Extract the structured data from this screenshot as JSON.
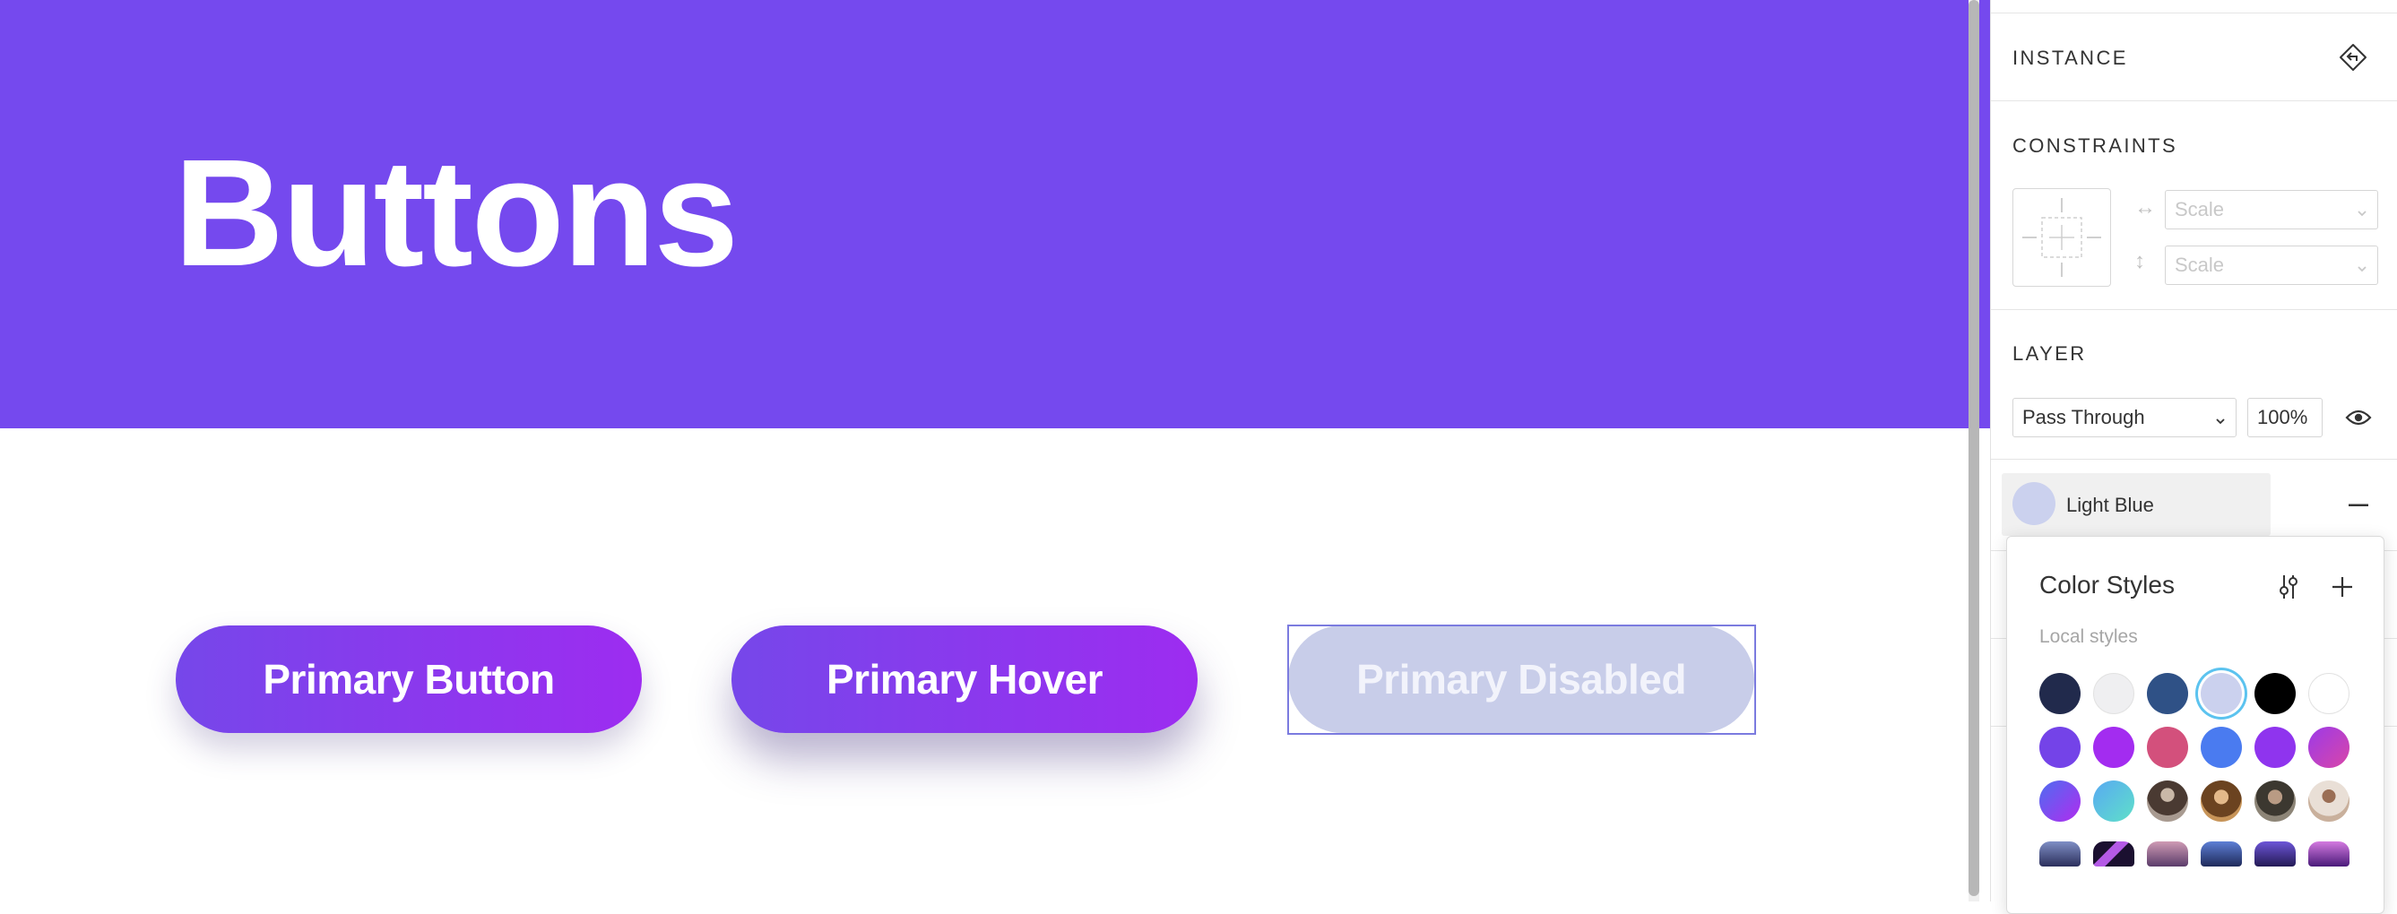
{
  "canvas": {
    "title": "Buttons",
    "buttons": [
      {
        "label": "Primary Button"
      },
      {
        "label": "Primary Hover"
      },
      {
        "label": "Primary Disabled"
      }
    ]
  },
  "panel": {
    "instance": {
      "title": "INSTANCE",
      "action_icon": "detach-instance-icon"
    },
    "constraints": {
      "title": "CONSTRAINTS",
      "horizontal": "Scale",
      "vertical": "Scale"
    },
    "layer": {
      "title": "LAYER",
      "blend_mode": "Pass Through",
      "opacity": "100%"
    },
    "fill": {
      "style_name": "Light Blue",
      "swatch_color": "#cbd1ee"
    },
    "color_styles": {
      "title": "Color Styles",
      "subtitle": "Local styles",
      "selected": "Light Blue",
      "colors": [
        "#212a4c",
        "#efeff1",
        "#2f5186",
        "#cbd1ee",
        "#000000",
        "#ffffff",
        "#7443e8",
        "#a32cf0",
        "#d3507c",
        "#4a7bf0",
        "#8f34ee",
        "#c03bd6"
      ],
      "gradients": [
        "purple-blue-gradient",
        "blue-teal-gradient"
      ],
      "photos": [
        "portrait-photo-1",
        "portrait-photo-2",
        "portrait-photo-3",
        "portrait-photo-4"
      ],
      "images": [
        "image-1",
        "image-2",
        "image-3",
        "image-4",
        "image-5",
        "image-6"
      ]
    }
  },
  "colors": {
    "accent": "#7549ee",
    "selection": "#7b7bdf",
    "disabled": "#c8cde9"
  }
}
